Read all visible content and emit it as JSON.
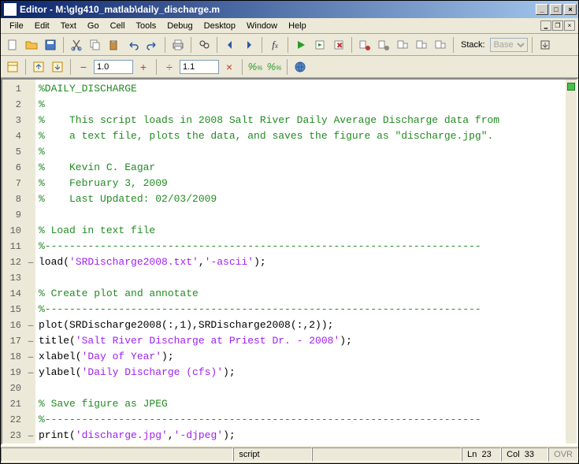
{
  "title": "Editor - M:\\glg410_matlab\\daily_discharge.m",
  "menu": [
    "File",
    "Edit",
    "Text",
    "Go",
    "Cell",
    "Tools",
    "Debug",
    "Desktop",
    "Window",
    "Help"
  ],
  "stack": {
    "label": "Stack:",
    "value": "Base"
  },
  "zoom": {
    "a": "1.0",
    "b": "1.1"
  },
  "status": {
    "type": "script",
    "ln": "Ln",
    "ln_v": "23",
    "col": "Col",
    "col_v": "33",
    "ovr": "OVR"
  },
  "code": [
    {
      "n": 1,
      "f": "",
      "spans": [
        {
          "cls": "c-comment",
          "t": "%DAILY_DISCHARGE"
        }
      ]
    },
    {
      "n": 2,
      "f": "",
      "spans": [
        {
          "cls": "c-comment",
          "t": "%"
        }
      ]
    },
    {
      "n": 3,
      "f": "",
      "spans": [
        {
          "cls": "c-comment",
          "t": "%    This script loads in 2008 Salt River Daily Average Discharge data from"
        }
      ]
    },
    {
      "n": 4,
      "f": "",
      "spans": [
        {
          "cls": "c-comment",
          "t": "%    a text file, plots the data, and saves the figure as \"discharge.jpg\"."
        }
      ]
    },
    {
      "n": 5,
      "f": "",
      "spans": [
        {
          "cls": "c-comment",
          "t": "%"
        }
      ]
    },
    {
      "n": 6,
      "f": "",
      "spans": [
        {
          "cls": "c-comment",
          "t": "%    Kevin C. Eagar"
        }
      ]
    },
    {
      "n": 7,
      "f": "",
      "spans": [
        {
          "cls": "c-comment",
          "t": "%    February 3, 2009"
        }
      ]
    },
    {
      "n": 8,
      "f": "",
      "spans": [
        {
          "cls": "c-comment",
          "t": "%    Last Updated: 02/03/2009"
        }
      ]
    },
    {
      "n": 9,
      "f": "",
      "spans": []
    },
    {
      "n": 10,
      "f": "",
      "spans": [
        {
          "cls": "c-comment",
          "t": "% Load in text file"
        }
      ]
    },
    {
      "n": 11,
      "f": "",
      "spans": [
        {
          "cls": "c-comment",
          "t": "%-----------------------------------------------------------------------"
        }
      ]
    },
    {
      "n": 12,
      "f": "–",
      "spans": [
        {
          "cls": "c-text",
          "t": "load("
        },
        {
          "cls": "c-string",
          "t": "'SRDischarge2008.txt'"
        },
        {
          "cls": "c-text",
          "t": ","
        },
        {
          "cls": "c-string",
          "t": "'-ascii'"
        },
        {
          "cls": "c-text",
          "t": ");"
        }
      ]
    },
    {
      "n": 13,
      "f": "",
      "spans": []
    },
    {
      "n": 14,
      "f": "",
      "spans": [
        {
          "cls": "c-comment",
          "t": "% Create plot and annotate"
        }
      ]
    },
    {
      "n": 15,
      "f": "",
      "spans": [
        {
          "cls": "c-comment",
          "t": "%-----------------------------------------------------------------------"
        }
      ]
    },
    {
      "n": 16,
      "f": "–",
      "spans": [
        {
          "cls": "c-text",
          "t": "plot(SRDischarge2008(:,1),SRDischarge2008(:,2));"
        }
      ]
    },
    {
      "n": 17,
      "f": "–",
      "spans": [
        {
          "cls": "c-text",
          "t": "title("
        },
        {
          "cls": "c-string",
          "t": "'Salt River Discharge at Priest Dr. - 2008'"
        },
        {
          "cls": "c-text",
          "t": ");"
        }
      ]
    },
    {
      "n": 18,
      "f": "–",
      "spans": [
        {
          "cls": "c-text",
          "t": "xlabel("
        },
        {
          "cls": "c-string",
          "t": "'Day of Year'"
        },
        {
          "cls": "c-text",
          "t": ");"
        }
      ]
    },
    {
      "n": 19,
      "f": "–",
      "spans": [
        {
          "cls": "c-text",
          "t": "ylabel("
        },
        {
          "cls": "c-string",
          "t": "'Daily Discharge (cfs)'"
        },
        {
          "cls": "c-text",
          "t": ");"
        }
      ]
    },
    {
      "n": 20,
      "f": "",
      "spans": []
    },
    {
      "n": 21,
      "f": "",
      "spans": [
        {
          "cls": "c-comment",
          "t": "% Save figure as JPEG"
        }
      ]
    },
    {
      "n": 22,
      "f": "",
      "spans": [
        {
          "cls": "c-comment",
          "t": "%-----------------------------------------------------------------------"
        }
      ]
    },
    {
      "n": 23,
      "f": "–",
      "spans": [
        {
          "cls": "c-text",
          "t": "print("
        },
        {
          "cls": "c-string",
          "t": "'discharge.jpg'"
        },
        {
          "cls": "c-text",
          "t": ","
        },
        {
          "cls": "c-string",
          "t": "'-djpeg'"
        },
        {
          "cls": "c-text",
          "t": ");"
        }
      ]
    }
  ],
  "icons": {
    "new": "new-file-icon",
    "open": "open-folder-icon",
    "save": "save-icon",
    "cut": "cut-icon",
    "copy": "copy-icon",
    "paste": "paste-icon",
    "undo": "undo-icon",
    "redo": "redo-icon",
    "print": "print-icon",
    "find": "find-icon",
    "back": "back-icon",
    "fwd": "fwd-icon",
    "fx": "fx-icon",
    "run": "run-icon",
    "runadv": "run-advance-icon",
    "stopdb": "stop-debug-icon",
    "bp": "breakpoint-icon",
    "bpclr": "clear-bp-icon",
    "step": "step-icon",
    "stepin": "step-in-icon",
    "stepout": "step-out-icon",
    "celltoggle": "cell-mode-icon",
    "cellup": "cell-up-icon",
    "celldn": "cell-dn-icon",
    "minus": "minus-icon",
    "plus": "plus-icon",
    "div": "divide-icon",
    "mult": "mult-icon",
    "evalcell": "eval-cell-icon",
    "evalcelladv": "eval-cell-adv-icon",
    "publish": "publish-icon",
    "dock": "dock-icon"
  }
}
